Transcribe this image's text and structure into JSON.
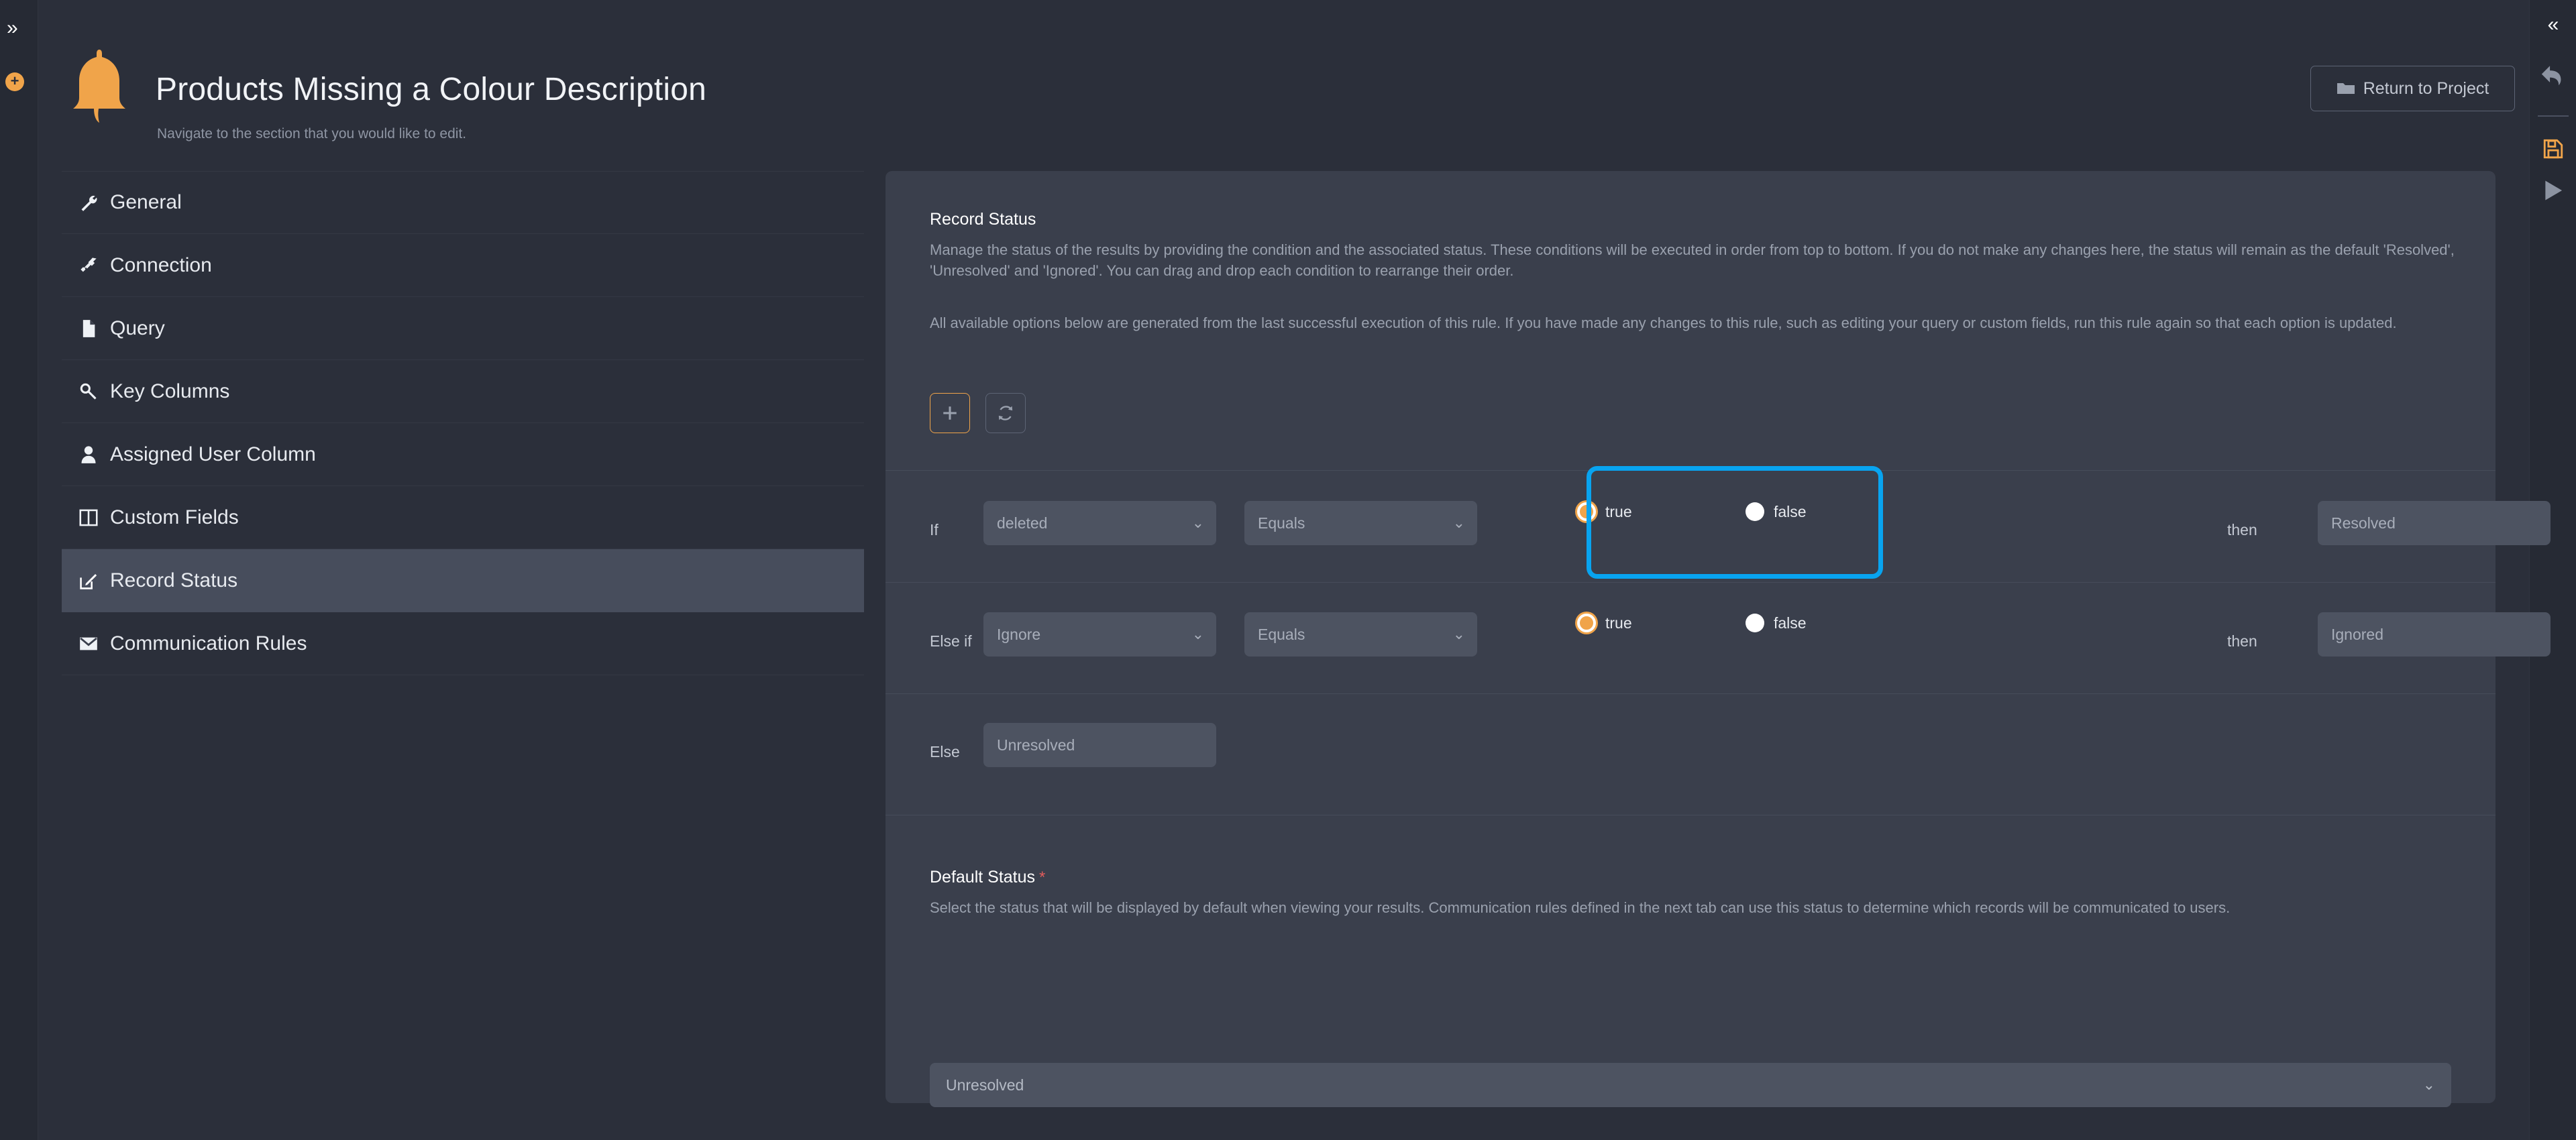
{
  "left_rail": {
    "expand_icon": "chevron-double-right",
    "add_icon": "plus-circle"
  },
  "right_rail": {
    "collapse_icon": "chevron-double-left",
    "undo_icon": "undo-arrow",
    "save_icon": "floppy-disk",
    "run_icon": "play-triangle"
  },
  "header": {
    "title": "Products Missing a Colour Description",
    "subtitle": "Navigate to the section that you would like to edit.",
    "bell_icon": "bell-icon",
    "return_button": "Return to Project",
    "return_icon": "folder-icon"
  },
  "sidebar": {
    "items": [
      {
        "label": "General",
        "icon": "wrench-icon",
        "active": false
      },
      {
        "label": "Connection",
        "icon": "plug-icon",
        "active": false
      },
      {
        "label": "Query",
        "icon": "file-icon",
        "active": false
      },
      {
        "label": "Key Columns",
        "icon": "key-icon",
        "active": false
      },
      {
        "label": "Assigned User Column",
        "icon": "user-icon",
        "active": false
      },
      {
        "label": "Custom Fields",
        "icon": "columns-icon",
        "active": false
      },
      {
        "label": "Record Status",
        "icon": "edit-square-icon",
        "active": true
      },
      {
        "label": "Communication Rules",
        "icon": "envelope-icon",
        "active": false
      }
    ]
  },
  "record_status": {
    "title": "Record Status",
    "paragraph_1": "Manage the status of the results by providing the condition and the associated status. These conditions will be executed in order from top to bottom. If you do not make any changes here, the status will remain as the default 'Resolved', 'Unresolved' and 'Ignored'. You can drag and drop each condition to rearrange their order.",
    "paragraph_2": "All available options below are generated from the last successful execution of this rule. If you have made any changes to this rule, such as editing your query or custom fields, run this rule again so that each option is updated.",
    "add_button_icon": "plus-icon",
    "refresh_button_icon": "refresh-icon",
    "then_label": "then",
    "delete_icon": "trash-icon",
    "more_icon": "kebab-menu-icon",
    "rows": [
      {
        "prefix": "If",
        "field": "deleted",
        "operator": "Equals",
        "value_true_label": "true",
        "value_false_label": "false",
        "selected_value": "true",
        "status": "Resolved",
        "highlighted": true
      },
      {
        "prefix": "Else if",
        "field": "Ignore",
        "operator": "Equals",
        "value_true_label": "true",
        "value_false_label": "false",
        "selected_value": "true",
        "status": "Ignored",
        "highlighted": false
      }
    ],
    "else_row": {
      "prefix": "Else",
      "status": "Unresolved"
    }
  },
  "default_status": {
    "title": "Default Status",
    "required_marker": "*",
    "description": "Select the status that will be displayed by default when viewing your results. Communication rules defined in the next tab can use this status to determine which records will be communicated to users.",
    "selected": "Unresolved"
  },
  "colors": {
    "accent_orange": "#f0a44a",
    "highlight_blue": "#08a4f0",
    "panel_bg": "#3a3f4c",
    "page_bg": "#2b2f3a",
    "required_red": "#e05c5c"
  }
}
